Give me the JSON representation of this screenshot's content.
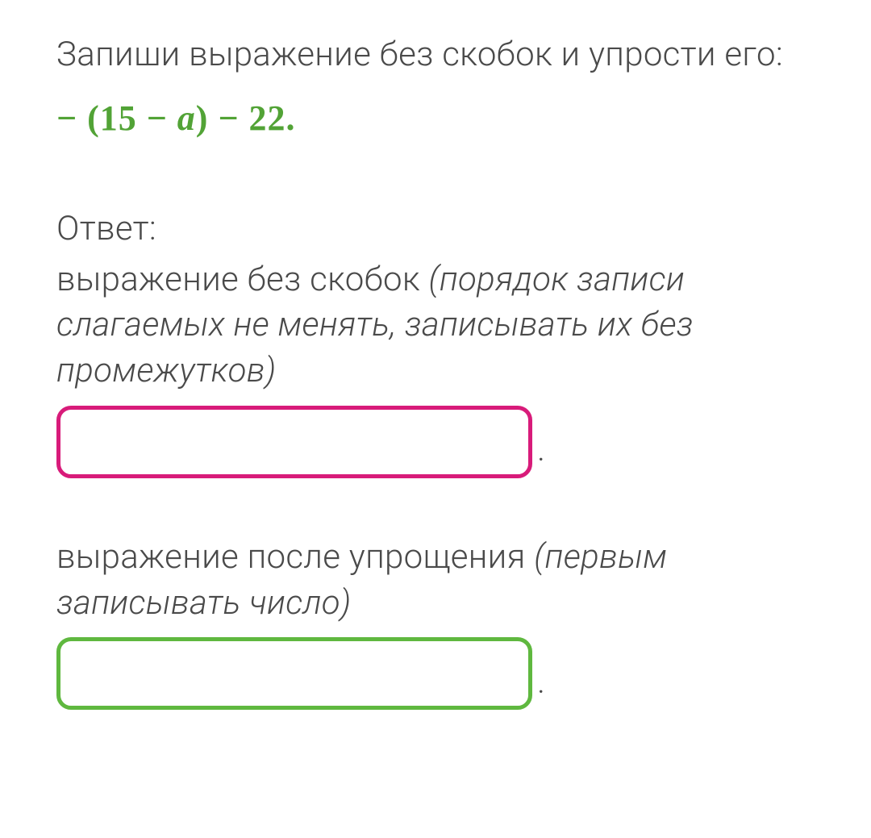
{
  "prompt": "Запиши выражение без скобок и упрости его:",
  "expression_prefix": "− (15 − ",
  "expression_var": "a",
  "expression_suffix": ") − 22",
  "answer_label": "Ответ:",
  "section1_text": "выражение без скобок ",
  "section1_hint": "(порядок записи слагаемых не менять, записывать их без промежутков)",
  "section2_text": "выражение после упрощения ",
  "section2_hint": "(первым записывать число)",
  "period": ".",
  "input1_value": "",
  "input2_value": ""
}
